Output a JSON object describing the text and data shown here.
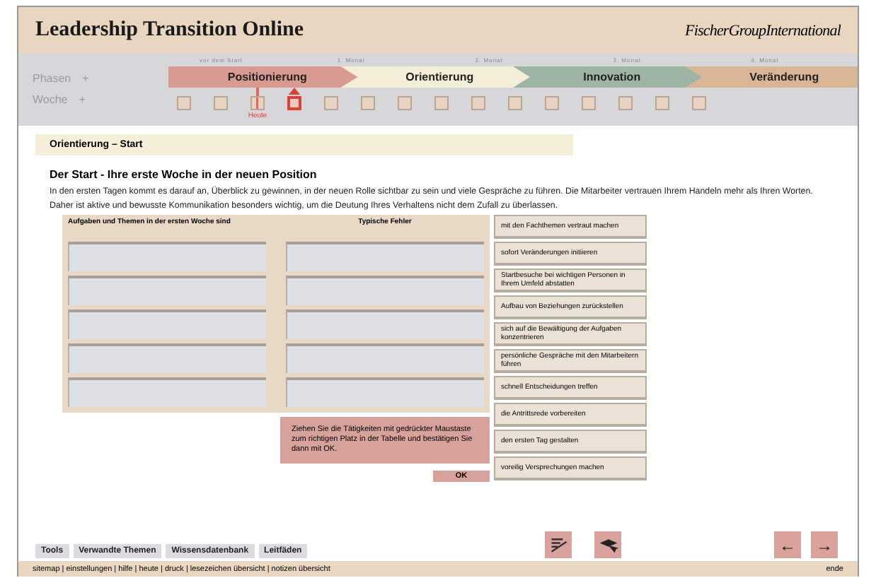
{
  "header": {
    "title": "Leadership Transition Online",
    "logo": "FischerGroupInternational"
  },
  "timeline": {
    "months": [
      "vor dem Start",
      "1. Monat",
      "2. Monat",
      "3. Monat",
      "4. Monat"
    ],
    "phases_label": "Phasen",
    "phases_toggle": "+",
    "weeks_label": "Woche",
    "weeks_toggle": "+",
    "today_label": "Heute",
    "phases": [
      {
        "label": "Positionierung",
        "color": "#d99a92"
      },
      {
        "label": "Orientierung",
        "color": "#f3eed8"
      },
      {
        "label": "Innovation",
        "color": "#9fb5a3"
      },
      {
        "label": "Veränderung",
        "color": "#d9b595"
      }
    ],
    "weeks": [
      {
        "selected": false,
        "today": false
      },
      {
        "selected": false,
        "today": false
      },
      {
        "selected": false,
        "today": true
      },
      {
        "selected": true,
        "today": false
      },
      {
        "selected": false,
        "today": false
      },
      {
        "selected": false,
        "today": false
      },
      {
        "selected": false,
        "today": false
      },
      {
        "selected": false,
        "today": false
      },
      {
        "selected": false,
        "today": false
      },
      {
        "selected": false,
        "today": false
      },
      {
        "selected": false,
        "today": false
      },
      {
        "selected": false,
        "today": false
      },
      {
        "selected": false,
        "today": false
      },
      {
        "selected": false,
        "today": false
      },
      {
        "selected": false,
        "today": false
      }
    ]
  },
  "section_title": "Orientierung – Start",
  "heading": "Der Start - Ihre erste Woche in der neuen Position",
  "intro": "In den ersten Tagen kommt es darauf an, Überblick zu gewinnen, in der neuen Rolle sichtbar zu sein und viele Gespräche zu führen. Die Mitarbeiter vertrauen Ihrem Handeln mehr als Ihren Worten. Daher ist aktive und bewusste Kommunikation besonders wichtig, um die Deutung Ihres Verhaltens nicht dem Zufall zu überlassen.",
  "table": {
    "columns": [
      {
        "heading": "Aufgaben und Themen in der ersten Woche sind"
      },
      {
        "heading": "Typische Fehler"
      }
    ]
  },
  "instruction": "Ziehen Sie die Tätigkeiten mit gedrückter Maustaste zum richtigen Platz in der Tabelle und bestätigen Sie dann mit OK.",
  "ok_button": "OK",
  "items": [
    "mit den Fachthemen vertraut machen",
    "sofort Veränderungen initiieren",
    "Startbesuche bei wichtigen Personen in Ihrem Umfeld abstatten",
    "Aufbau von Beziehungen zurückstellen",
    "sich auf die Bewältigung der Aufgaben konzentrieren",
    "persönliche Gespräche mit den Mitarbeitern führen",
    "schnell Entscheidungen treffen",
    "die Antrittsrede vorbereiten",
    "den ersten Tag gestalten",
    "voreilig Versprechungen machen"
  ],
  "tabs": [
    {
      "label": "Tools",
      "selected": false
    },
    {
      "label": "Verwandte Themen",
      "selected": false
    },
    {
      "label": "Wissensdatenbank",
      "selected": false
    },
    {
      "label": "Leitfäden",
      "selected": false
    }
  ],
  "nav": {
    "back": "←",
    "forward": "→"
  },
  "footer": {
    "links": "sitemap | einstellungen | hilfe | heute | druck | lesezeichen übersicht | notizen übersicht",
    "end": "ende"
  }
}
